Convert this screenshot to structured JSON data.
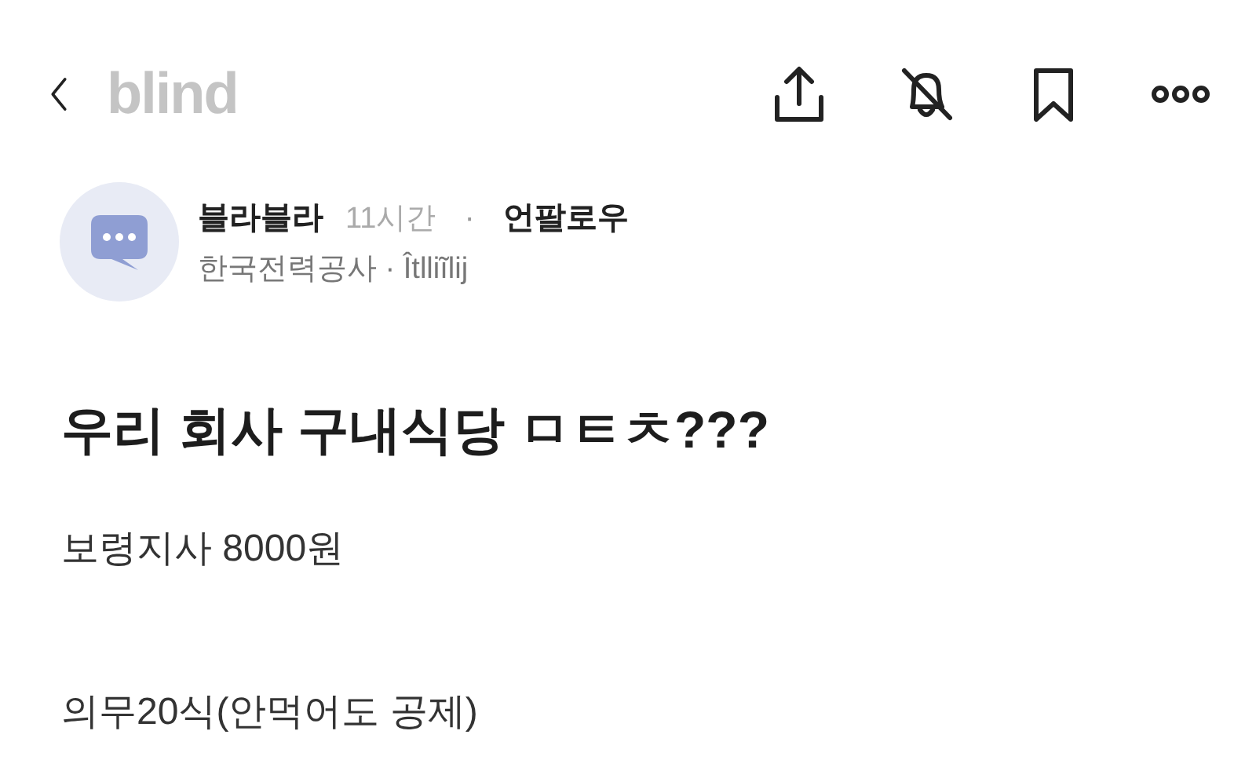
{
  "header": {
    "logo": "blind"
  },
  "post": {
    "author": "블라블라",
    "time": "11시간",
    "separator": "·",
    "follow": "언팔로우",
    "company": "한국전력공사 · Îtlliĩlij",
    "title": "우리 회사 구내식당 ㅁㅌㅊ???",
    "body": [
      "보령지사 8000원",
      "의무20식(안먹어도 공제)"
    ]
  }
}
